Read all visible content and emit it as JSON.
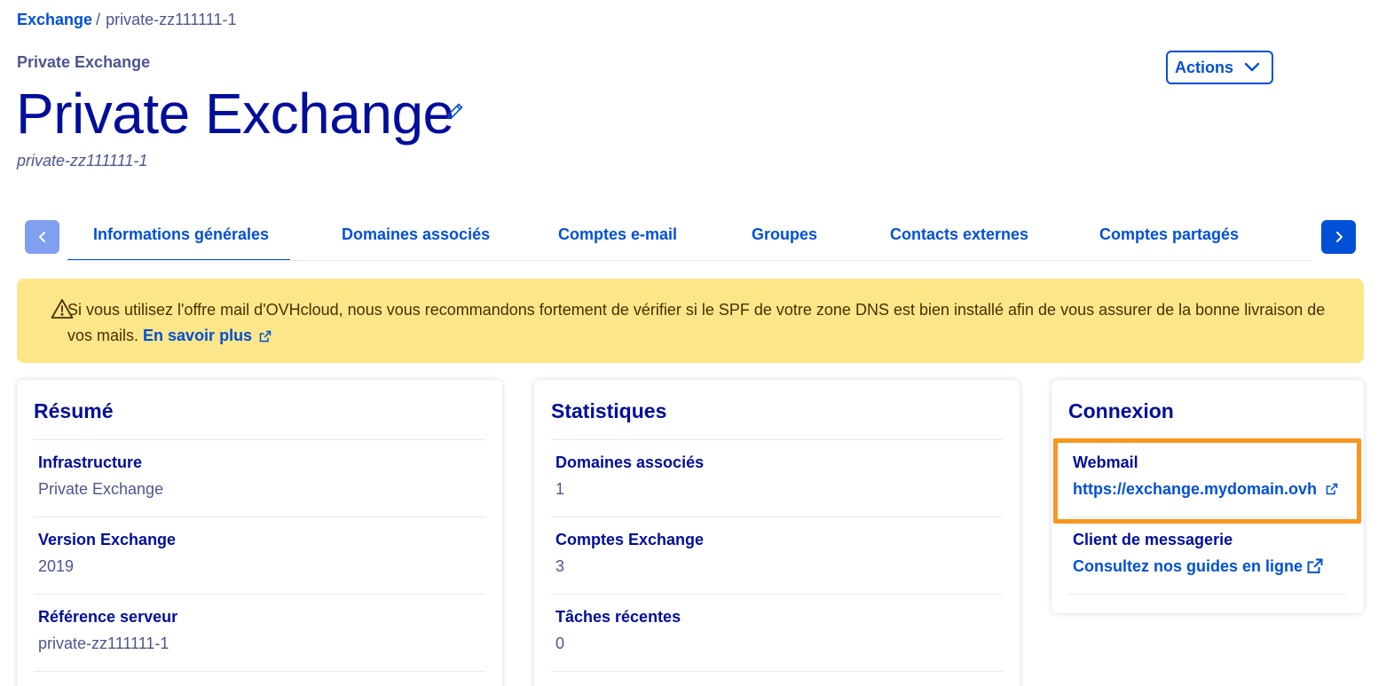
{
  "breadcrumb": {
    "root": "Exchange",
    "separator": "/",
    "current": "private-zz111111-1"
  },
  "header": {
    "eyebrow": "Private Exchange",
    "title": "Private Exchange",
    "subtitle": "private-zz111111-1",
    "actions_label": "Actions"
  },
  "tabs": [
    {
      "label": "Informations générales",
      "active": true
    },
    {
      "label": "Domaines associés",
      "active": false
    },
    {
      "label": "Comptes e-mail",
      "active": false
    },
    {
      "label": "Groupes",
      "active": false
    },
    {
      "label": "Contacts externes",
      "active": false
    },
    {
      "label": "Comptes partagés",
      "active": false
    }
  ],
  "banner": {
    "text": "Si vous utilisez l'offre mail d'OVHcloud, nous vous recommandons fortement de vérifier si le SPF de votre zone DNS est bien installé afin de vous assurer de la bonne livraison de vos mails.",
    "link": "En savoir plus"
  },
  "resume": {
    "title": "Résumé",
    "rows": [
      {
        "label": "Infrastructure",
        "value": "Private Exchange"
      },
      {
        "label": "Version Exchange",
        "value": "2019"
      },
      {
        "label": "Référence serveur",
        "value": "private-zz111111-1"
      }
    ]
  },
  "stats": {
    "title": "Statistiques",
    "rows": [
      {
        "label": "Domaines associés",
        "value": "1"
      },
      {
        "label": "Comptes Exchange",
        "value": "3"
      },
      {
        "label": "Tâches récentes",
        "value": "0"
      }
    ]
  },
  "connexion": {
    "title": "Connexion",
    "webmail_label": "Webmail",
    "webmail_url": "https://exchange.mydomain.ovh",
    "client_label": "Client de messagerie",
    "client_link": "Consultez nos guides en ligne"
  },
  "colors": {
    "primary": "#0050d7",
    "heading": "#000e9c",
    "banner_bg": "#fbe68a",
    "highlight": "#f8961e"
  }
}
